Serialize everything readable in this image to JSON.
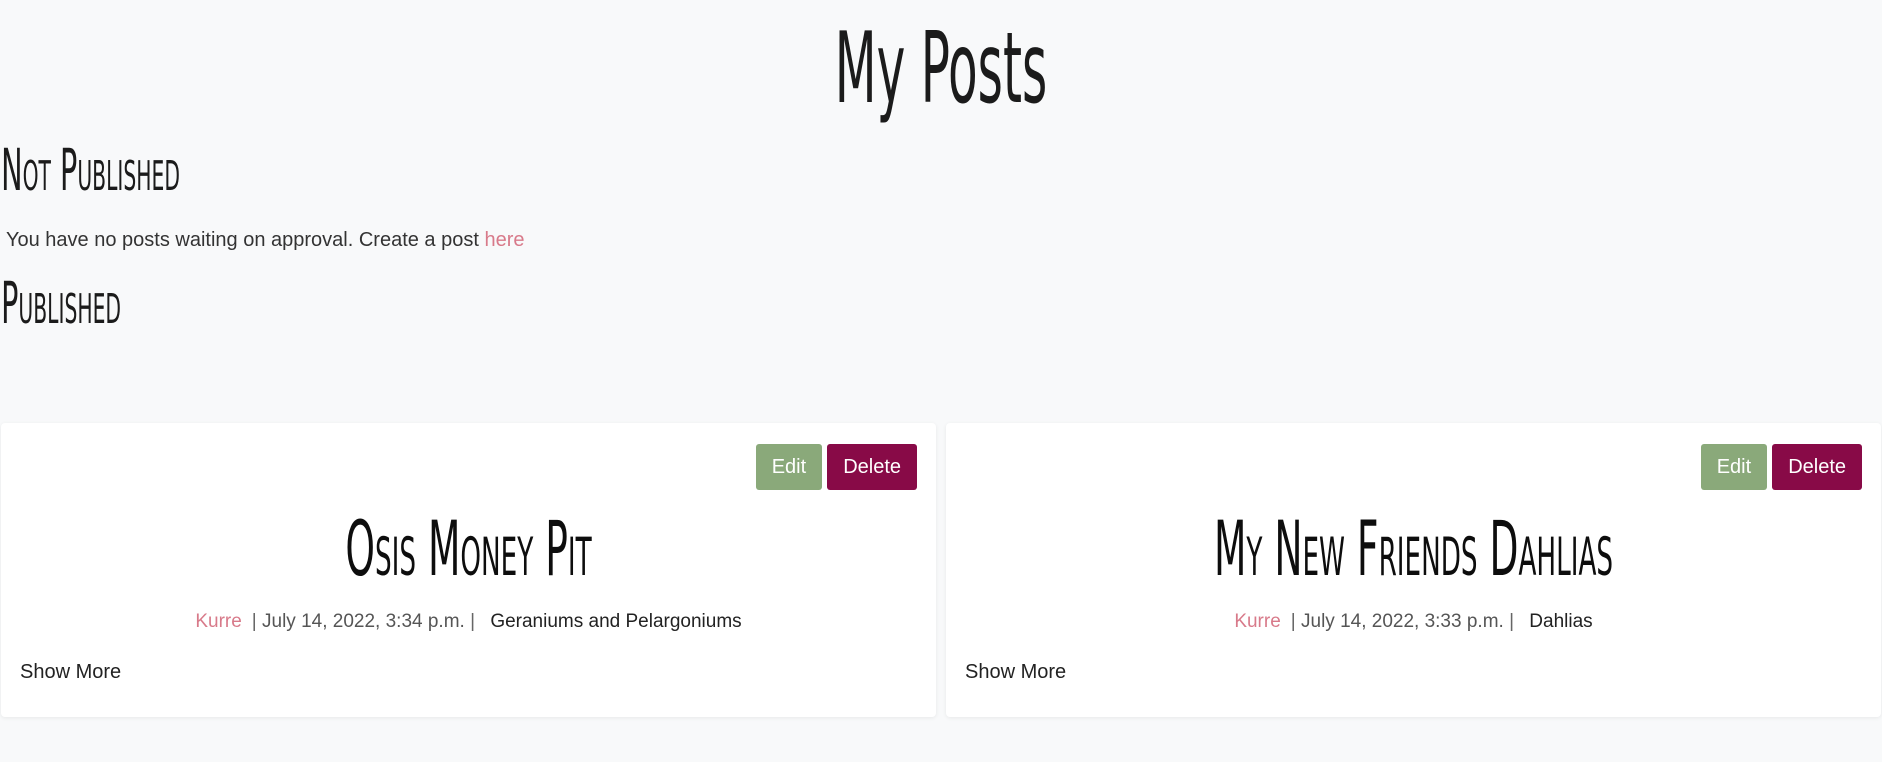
{
  "page": {
    "title": "My Posts"
  },
  "not_published": {
    "heading": "Not Published",
    "message": "You have no posts waiting on approval. Create a post",
    "link_text": "here"
  },
  "published": {
    "heading": "Published",
    "posts": [
      {
        "title": "Osis Money Pit",
        "author": "Kurre",
        "date": "July 14, 2022, 3:34 p.m.",
        "category": "Geraniums and Pelargoniums",
        "edit_label": "Edit",
        "delete_label": "Delete",
        "show_more_label": "Show More"
      },
      {
        "title": "My New Friends Dahlias",
        "author": "Kurre",
        "date": "July 14, 2022, 3:33 p.m.",
        "category": "Dahlias",
        "edit_label": "Edit",
        "delete_label": "Delete",
        "show_more_label": "Show More"
      }
    ]
  },
  "colors": {
    "edit_button": "#8aa97a",
    "delete_button": "#880a47",
    "link_accent": "#d87a8a",
    "background": "#f8f9fa"
  }
}
